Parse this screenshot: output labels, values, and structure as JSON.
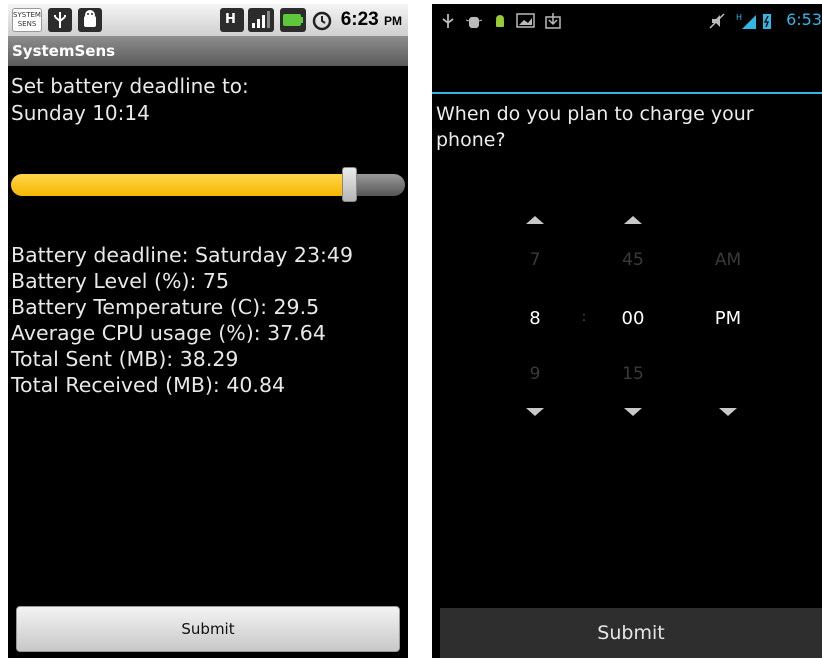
{
  "left": {
    "status_bar": {
      "logo_text_line1": "SYSTEM",
      "logo_text_line2": "SENS",
      "time": "6:23",
      "ampm": "PM",
      "icons": [
        "usb-icon",
        "android-icon",
        "network-h-icon",
        "signal-icon",
        "battery-icon",
        "alarm-icon"
      ]
    },
    "app_title": "SystemSens",
    "prompt_line1": "Set battery deadline to:",
    "prompt_line2": "Sunday 10:14",
    "slider": {
      "value_fraction": 0.87,
      "fill_color": "#f5b800"
    },
    "stats": [
      "Battery deadline: Saturday 23:49",
      "Battery Level (%): 75",
      "Battery Temperature (C): 29.5",
      "Average CPU usage (%): 37.64",
      "Total Sent (MB): 38.29",
      "Total Received (MB): 40.84"
    ],
    "submit_label": "Submit"
  },
  "right": {
    "status_bar": {
      "time": "6:53",
      "icons": [
        "usb-icon",
        "debug-icon",
        "android-icon",
        "image-icon",
        "download-icon",
        "mute-icon",
        "signal-icon",
        "battery-icon"
      ],
      "accent_color": "#33b5e5"
    },
    "question": "When do you plan to charge your phone?",
    "picker": {
      "hour_prev": "7",
      "hour": "8",
      "hour_next": "9",
      "separator": ":",
      "minute_prev": "45",
      "minute": "00",
      "minute_next": "15",
      "ampm_prev": "AM",
      "ampm": "PM"
    },
    "submit_label": "Submit"
  }
}
